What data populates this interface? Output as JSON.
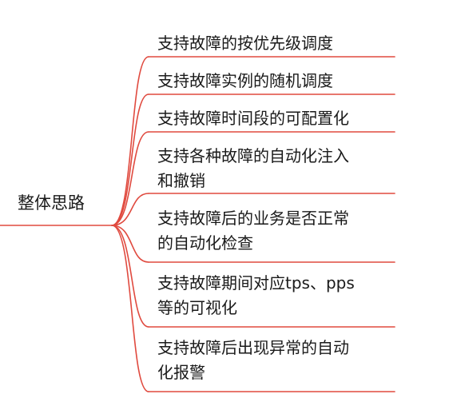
{
  "colors": {
    "line": "#e04a3f",
    "text": "#1a1a1a",
    "background": "#ffffff"
  },
  "mindmap": {
    "root": "整体思路",
    "branches": [
      {
        "lines": [
          "支持故障的按优先级调度"
        ]
      },
      {
        "lines": [
          "支持故障实例的随机调度"
        ]
      },
      {
        "lines": [
          "支持故障时间段的可配置化"
        ]
      },
      {
        "lines": [
          "支持各种故障的自动化注入",
          "和撤销"
        ]
      },
      {
        "lines": [
          "支持故障后的业务是否正常",
          "的自动化检查"
        ]
      },
      {
        "lines": [
          "支持故障期间对应tps、pps",
          "等的可视化"
        ]
      },
      {
        "lines": [
          "支持故障后出现异常的自动",
          "化报警"
        ]
      }
    ]
  }
}
